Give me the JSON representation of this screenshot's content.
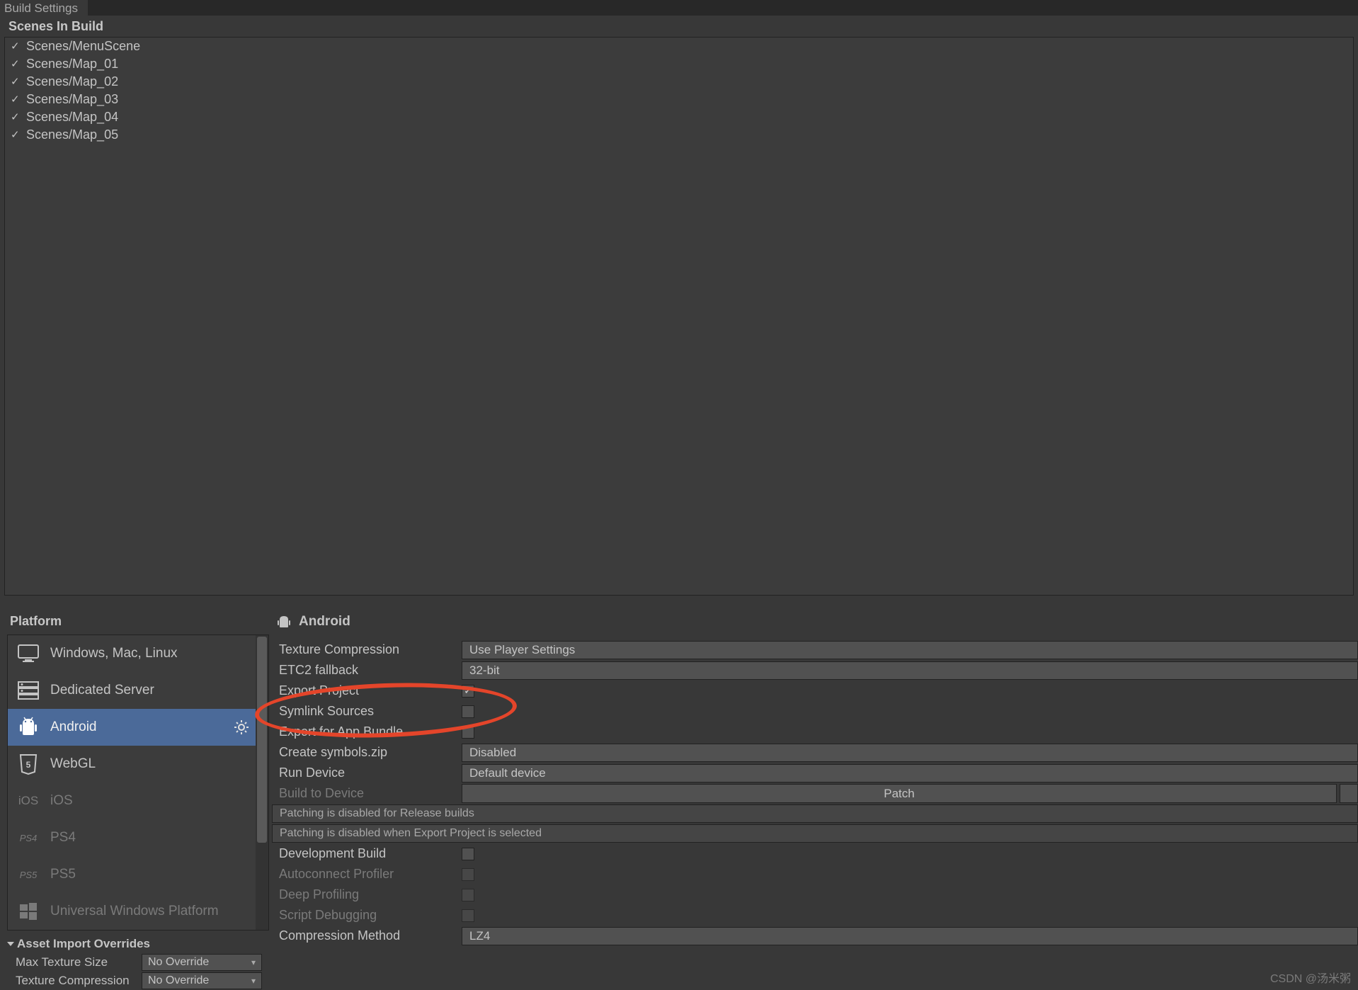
{
  "tab_title": "Build Settings",
  "scenes_header": "Scenes In Build",
  "scenes": [
    "Scenes/MenuScene",
    "Scenes/Map_01",
    "Scenes/Map_02",
    "Scenes/Map_03",
    "Scenes/Map_04",
    "Scenes/Map_05"
  ],
  "platform_header": "Platform",
  "platforms": [
    {
      "label": "Windows, Mac, Linux",
      "state": "normal"
    },
    {
      "label": "Dedicated Server",
      "state": "normal"
    },
    {
      "label": "Android",
      "state": "selected"
    },
    {
      "label": "WebGL",
      "state": "normal"
    },
    {
      "label": "iOS",
      "state": "disabled"
    },
    {
      "label": "PS4",
      "state": "disabled"
    },
    {
      "label": "PS5",
      "state": "disabled"
    },
    {
      "label": "Universal Windows Platform",
      "state": "disabled"
    }
  ],
  "overrides": {
    "title": "Asset Import Overrides",
    "max_texture_label": "Max Texture Size",
    "max_texture_value": "No Override",
    "tex_comp_label": "Texture Compression",
    "tex_comp_value": "No Override"
  },
  "right": {
    "title": "Android",
    "rows": {
      "texture_compression": {
        "label": "Texture Compression",
        "value": "Use Player Settings"
      },
      "etc2_fallback": {
        "label": "ETC2 fallback",
        "value": "32-bit"
      },
      "export_project": {
        "label": "Export Project",
        "checked": true
      },
      "symlink_sources": {
        "label": "Symlink Sources",
        "checked": false
      },
      "export_app_bundle": {
        "label": "Export for App Bundle",
        "checked": false
      },
      "create_symbols": {
        "label": "Create symbols.zip",
        "value": "Disabled"
      },
      "run_device": {
        "label": "Run Device",
        "value": "Default device"
      },
      "build_to_device": {
        "label": "Build to Device",
        "button": "Patch"
      },
      "note1": "Patching is disabled for Release builds",
      "note2": "Patching is disabled when Export Project is selected",
      "dev_build": {
        "label": "Development Build",
        "checked": false
      },
      "autoconnect": {
        "label": "Autoconnect Profiler",
        "checked": false
      },
      "deep_profiling": {
        "label": "Deep Profiling",
        "checked": false
      },
      "script_debugging": {
        "label": "Script Debugging",
        "checked": false
      },
      "compression_method": {
        "label": "Compression Method",
        "value": "LZ4"
      }
    }
  },
  "watermark": "CSDN @汤米粥"
}
